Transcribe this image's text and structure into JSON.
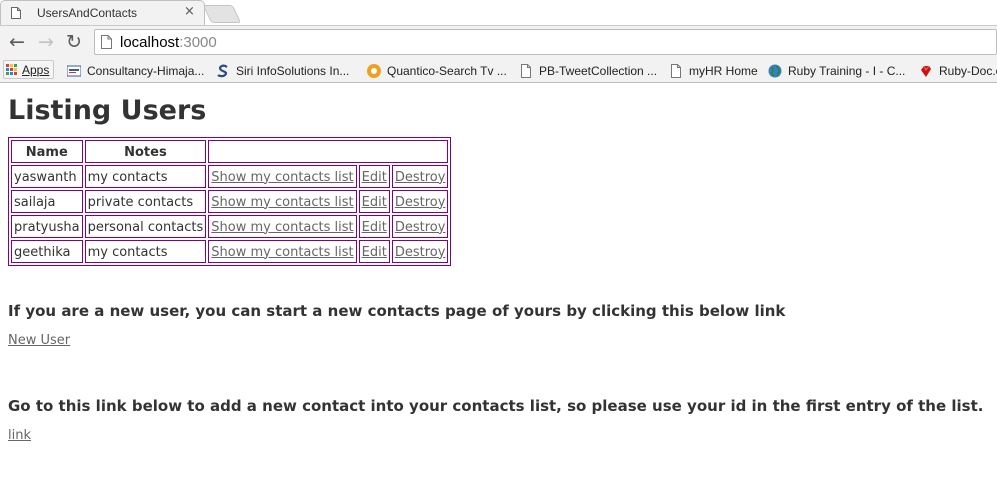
{
  "browser": {
    "tab": {
      "title": "UsersAndContacts",
      "close": "×"
    },
    "nav": {
      "back": "←",
      "forward": "→",
      "reload": "↻"
    },
    "address": {
      "host": "localhost",
      "port": ":3000"
    },
    "bookmarks": [
      {
        "label": "Apps",
        "icon": "apps-grid-icon"
      },
      {
        "label": "Consultancy-Himaja...",
        "icon": "site-logo-icon",
        "color": "#3a5a9a"
      },
      {
        "label": "Siri InfoSolutions In...",
        "icon": "swirl-logo-icon",
        "color": "#2a4a8a"
      },
      {
        "label": "Quantico-Search Tv ...",
        "icon": "quantico-logo-icon",
        "color": "#f0a020"
      },
      {
        "label": "PB-TweetCollection ...",
        "icon": "page-icon",
        "color": "#777777"
      },
      {
        "label": "myHR Home",
        "icon": "page-icon",
        "color": "#777777"
      },
      {
        "label": "Ruby Training - I - C...",
        "icon": "globe-icon",
        "color": "#2a8a3a"
      },
      {
        "label": "Ruby-Doc.o",
        "icon": "ruby-icon",
        "color": "#cc1111"
      }
    ]
  },
  "page": {
    "title": "Listing Users",
    "table": {
      "headers": [
        "Name",
        "Notes",
        ""
      ],
      "rows": [
        {
          "name": "yaswanth",
          "notes": "my contacts",
          "show": "Show my contacts list",
          "edit": "Edit",
          "destroy": "Destroy"
        },
        {
          "name": "sailaja",
          "notes": "private contacts",
          "show": "Show my contacts list",
          "edit": "Edit",
          "destroy": "Destroy"
        },
        {
          "name": "pratyusha",
          "notes": "personal contacts",
          "show": "Show my contacts list",
          "edit": "Edit",
          "destroy": "Destroy"
        },
        {
          "name": "geethika",
          "notes": "my contacts",
          "show": "Show my contacts list",
          "edit": "Edit",
          "destroy": "Destroy"
        }
      ]
    },
    "new_user_text": "If you are a new user, you can start a new contacts page of yours by clicking this below link",
    "new_user_link": "New User",
    "contact_text": "Go to this link below to add a new contact into your contacts list, so please use your id in the first entry of the list.",
    "contact_link": "link"
  },
  "colors": {
    "table_border": "#800080",
    "link": "#666666",
    "text": "#333333"
  }
}
